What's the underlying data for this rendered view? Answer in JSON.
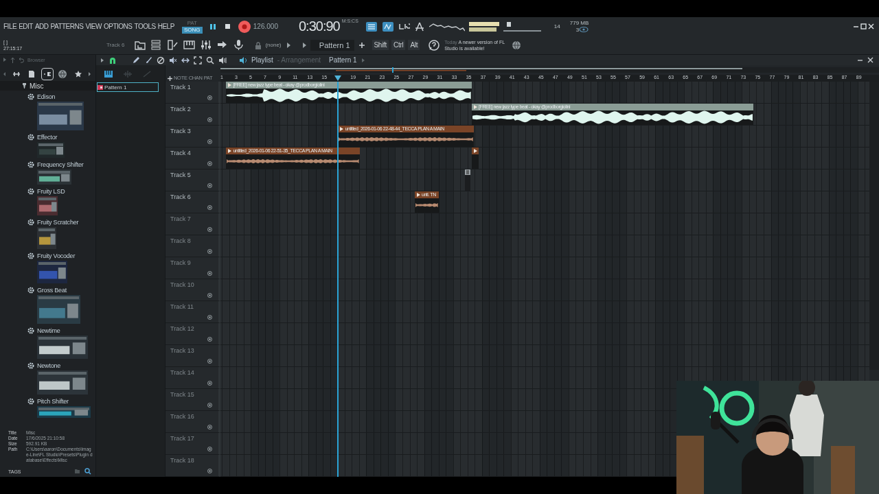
{
  "menu": [
    "FILE",
    "EDIT",
    "ADD",
    "PATTERNS",
    "VIEW",
    "OPTIONS",
    "TOOLS",
    "HELP"
  ],
  "hint_bar": {
    "title": "[ ]",
    "text": "27:15:17"
  },
  "transport": {
    "modes": [
      {
        "label": "PAT",
        "selected": false
      },
      {
        "label": "SONG",
        "selected": true
      }
    ],
    "tempo": "126.000",
    "time": "0:30:90",
    "time_unit": "M:S:CS"
  },
  "monitor": {
    "cpu": "14",
    "memory": "779 MB",
    "polyphony": "3"
  },
  "toolbar": {
    "track": "Track 6",
    "output": "(none)",
    "pattern": "Pattern 1",
    "keys": [
      "Shift",
      "Ctrl",
      "Alt"
    ],
    "news": {
      "date": "Today",
      "text": "A newer version of FL Studio is available!"
    }
  },
  "browser": {
    "title": "Browser",
    "tabs": [
      {
        "selected": false
      },
      {
        "selected": false
      },
      {
        "selected": true
      },
      {
        "selected": false
      },
      {
        "selected": false
      }
    ],
    "folder": "Misc",
    "items": [
      {
        "name": "Edison"
      },
      {
        "name": "Effector"
      },
      {
        "name": "Frequency Shifter"
      },
      {
        "name": "Fruity LSD"
      },
      {
        "name": "Fruity Scratcher"
      },
      {
        "name": "Fruity Vocoder"
      },
      {
        "name": "Gross Beat"
      },
      {
        "name": "Newtime"
      },
      {
        "name": "Newtone"
      },
      {
        "name": "Pitch Shifter"
      }
    ],
    "info": [
      {
        "label": "Title",
        "value": "Misc"
      },
      {
        "label": "Date",
        "value": "17/6/2025 21:10:58"
      },
      {
        "label": "Size",
        "value": "592.91 KB"
      },
      {
        "label": "Path",
        "value": "C:\\Users\\aaron\\Documents\\Image-Line\\FL Studio\\Presets\\Plugin database\\Effects\\Misc"
      }
    ],
    "tags": "TAGS"
  },
  "playlist": {
    "title": "Playlist",
    "subtitle": "- Arrangement",
    "pattern": "Pattern 1",
    "picker": [
      {
        "label": "Pattern 1",
        "selected": true
      }
    ],
    "ruler_modes": [
      "NOTE",
      "CHAN",
      "PAT"
    ],
    "ruler": [
      "1",
      "3",
      "5",
      "7",
      "9",
      "11",
      "13",
      "15",
      "19",
      "21",
      "23",
      "25",
      "27",
      "29",
      "31",
      "33",
      "35",
      "37",
      "39",
      "41",
      "43",
      "45",
      "47",
      "49",
      "51",
      "53",
      "55",
      "57",
      "59",
      "61",
      "63",
      "65",
      "67",
      "69",
      "71",
      "73",
      "75",
      "77",
      "79",
      "81",
      "83",
      "85",
      "87",
      "89"
    ],
    "tracks": [
      {
        "name": "Track 1",
        "dimmed": false,
        "clips": [
          {
            "kind": "audio",
            "label": "[FREE] new jazz type beat  -  okay @prodborgiolini",
            "color": "#8a9c95"
          }
        ]
      },
      {
        "name": "Track 2",
        "dimmed": false,
        "clips": [
          {
            "kind": "audio",
            "label": "[FREE] new jazz type beat  -  okay @prodborgiolini",
            "color": "#8a9c95"
          }
        ]
      },
      {
        "name": "Track 3",
        "dimmed": false,
        "clips": [
          {
            "kind": "audio",
            "label": "untitled_2026-01-06 22-48-44_TECCA PLAN A MAIN",
            "color": "#7a4427"
          }
        ]
      },
      {
        "name": "Track 4",
        "dimmed": false,
        "clips": [
          {
            "kind": "audio",
            "label": "untitled_2026-01-06 22-51-35_TECCA PLAN A MAIN",
            "color": "#7a4427"
          },
          {
            "kind": "audio",
            "color": "#7a4427"
          }
        ]
      },
      {
        "name": "Track 5",
        "dimmed": false,
        "clips": [
          {
            "kind": "pattern",
            "color": "#9aa0a4"
          }
        ]
      },
      {
        "name": "Track 6",
        "dimmed": false,
        "clips": [
          {
            "kind": "audio",
            "label": "unti. TN",
            "color": "#7a4427"
          }
        ]
      },
      {
        "name": "Track 7",
        "dimmed": true
      },
      {
        "name": "Track 8",
        "dimmed": true
      },
      {
        "name": "Track 9",
        "dimmed": true
      },
      {
        "name": "Track 10",
        "dimmed": true
      },
      {
        "name": "Track 11",
        "dimmed": true
      },
      {
        "name": "Track 12",
        "dimmed": true
      },
      {
        "name": "Track 13",
        "dimmed": true
      },
      {
        "name": "Track 14",
        "dimmed": true
      },
      {
        "name": "Track 15",
        "dimmed": true
      },
      {
        "name": "Track 16",
        "dimmed": true
      },
      {
        "name": "Track 17",
        "dimmed": true
      },
      {
        "name": "Track 18",
        "dimmed": true
      }
    ]
  }
}
